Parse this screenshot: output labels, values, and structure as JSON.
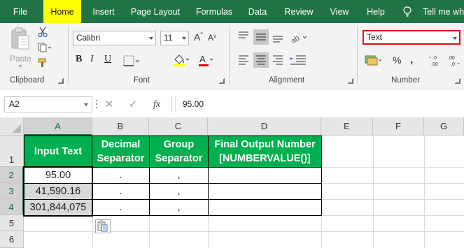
{
  "tabs": [
    {
      "label": "File",
      "active": false
    },
    {
      "label": "Home",
      "active": true
    },
    {
      "label": "Insert",
      "active": false
    },
    {
      "label": "Page Layout",
      "active": false
    },
    {
      "label": "Formulas",
      "active": false
    },
    {
      "label": "Data",
      "active": false
    },
    {
      "label": "Review",
      "active": false
    },
    {
      "label": "View",
      "active": false
    },
    {
      "label": "Help",
      "active": false
    }
  ],
  "tell_me": "Tell me wha",
  "ribbon": {
    "clipboard": {
      "label": "Clipboard",
      "paste_label": "Paste"
    },
    "font": {
      "label": "Font",
      "font_name": "Calibri",
      "font_size": "11",
      "bold": "B",
      "italic": "I",
      "underline": "U"
    },
    "alignment": {
      "label": "Alignment"
    },
    "number": {
      "label": "Number",
      "format": "Text",
      "percent": "%",
      "comma": "9",
      "inc_decimal": "←.0\n.00",
      "dec_decimal": ".00\n→.0"
    }
  },
  "formula_bar": {
    "name_box": "A2",
    "fx": "fx",
    "content": "95.00"
  },
  "columns": [
    {
      "label": "A",
      "selected": true
    },
    {
      "label": "B",
      "selected": false
    },
    {
      "label": "C",
      "selected": false
    },
    {
      "label": "D",
      "selected": false
    },
    {
      "label": "E",
      "selected": false
    },
    {
      "label": "F",
      "selected": false
    },
    {
      "label": "G",
      "selected": false
    }
  ],
  "rows": [
    {
      "label": "1",
      "selected": false
    },
    {
      "label": "2",
      "selected": true
    },
    {
      "label": "3",
      "selected": true
    },
    {
      "label": "4",
      "selected": true
    },
    {
      "label": "5",
      "selected": false
    },
    {
      "label": "6",
      "selected": false
    }
  ],
  "table": {
    "headers": {
      "a": "Input Text",
      "b1": "Decimal",
      "b2": "Separator",
      "c1": "Group",
      "c2": "Separator",
      "d1": "Final Output Number",
      "d2": "[NUMBERVALUE()]"
    },
    "rows": [
      {
        "input": "95.00",
        "decimal": ".",
        "group": ",",
        "output": ""
      },
      {
        "input": "41,590.16",
        "decimal": ".",
        "group": ",",
        "output": ""
      },
      {
        "input": "301,844,075",
        "decimal": ".",
        "group": ",",
        "output": ""
      }
    ]
  },
  "colors": {
    "ribbon_green": "#217346",
    "header_green": "#00b050",
    "highlight": "#ffff00",
    "selection_grey": "#d9d9d9",
    "format_box_border": "#e01010"
  }
}
